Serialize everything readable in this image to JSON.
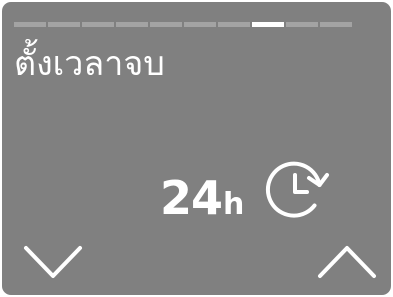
{
  "header": {
    "title": "ตั้งเวลาจบ",
    "progress": {
      "total_steps": 10,
      "current_step": 8
    }
  },
  "setting": {
    "value": "24",
    "unit": "h",
    "icon": "timer-clock-icon"
  },
  "controls": {
    "down_icon": "chevron-down-icon",
    "up_icon": "chevron-up-icon"
  },
  "colors": {
    "panel": "#808080",
    "segment_inactive": "#a3a3a3",
    "segment_active": "#ffffff",
    "foreground": "#ffffff"
  }
}
